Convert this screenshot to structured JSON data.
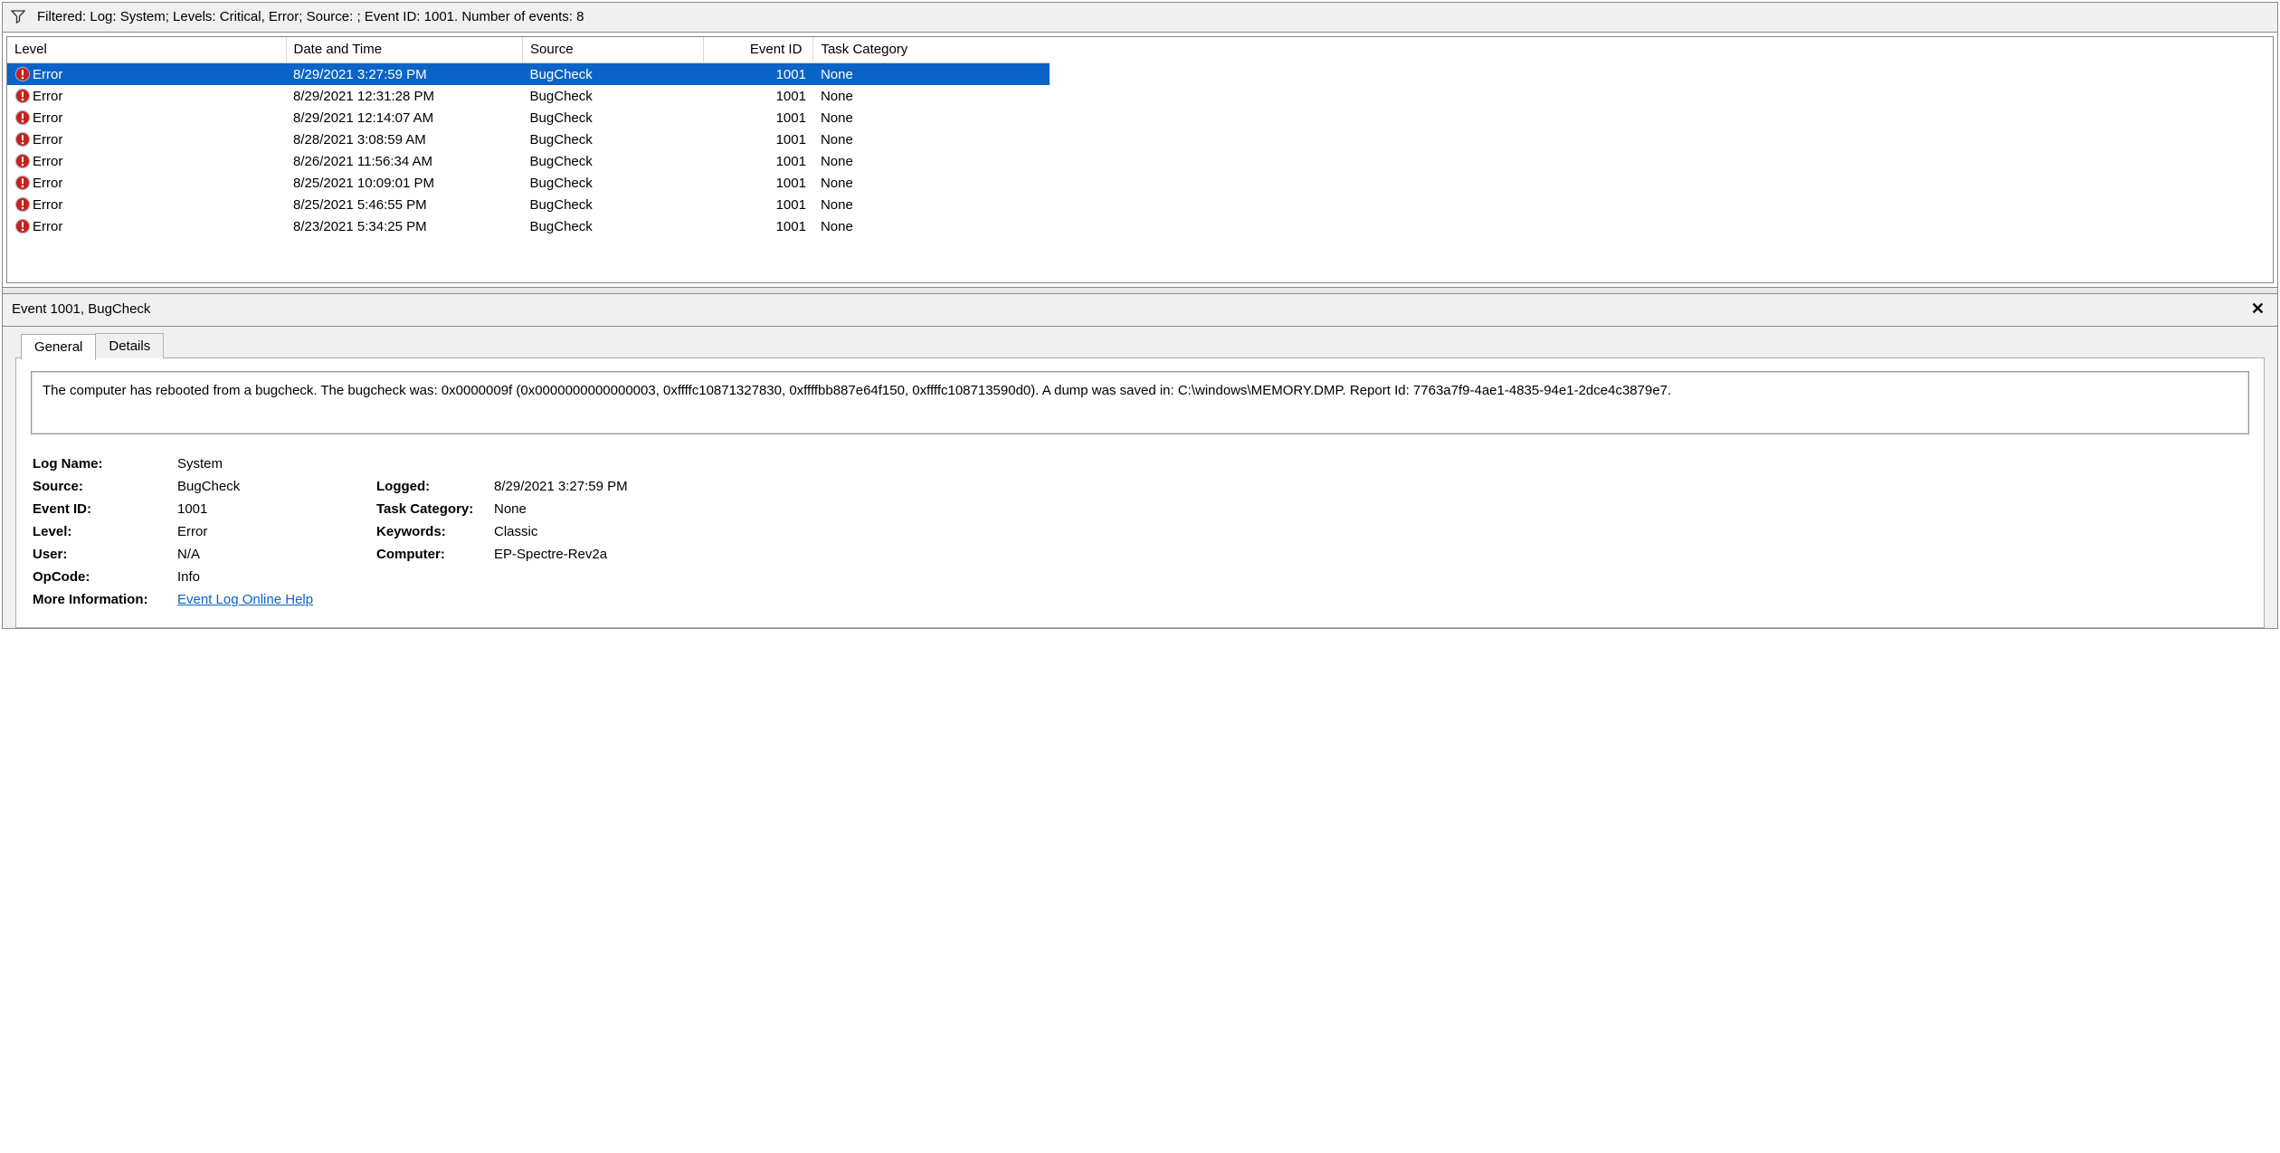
{
  "filter_text": "Filtered: Log: System; Levels: Critical, Error; Source: ; Event ID: 1001. Number of events: 8",
  "columns": {
    "level": "Level",
    "datetime": "Date and Time",
    "source": "Source",
    "eventid": "Event ID",
    "taskcat": "Task Category"
  },
  "events": [
    {
      "level": "Error",
      "datetime": "8/29/2021 3:27:59 PM",
      "source": "BugCheck",
      "eventid": "1001",
      "taskcat": "None",
      "selected": true
    },
    {
      "level": "Error",
      "datetime": "8/29/2021 12:31:28 PM",
      "source": "BugCheck",
      "eventid": "1001",
      "taskcat": "None",
      "selected": false
    },
    {
      "level": "Error",
      "datetime": "8/29/2021 12:14:07 AM",
      "source": "BugCheck",
      "eventid": "1001",
      "taskcat": "None",
      "selected": false
    },
    {
      "level": "Error",
      "datetime": "8/28/2021 3:08:59 AM",
      "source": "BugCheck",
      "eventid": "1001",
      "taskcat": "None",
      "selected": false
    },
    {
      "level": "Error",
      "datetime": "8/26/2021 11:56:34 AM",
      "source": "BugCheck",
      "eventid": "1001",
      "taskcat": "None",
      "selected": false
    },
    {
      "level": "Error",
      "datetime": "8/25/2021 10:09:01 PM",
      "source": "BugCheck",
      "eventid": "1001",
      "taskcat": "None",
      "selected": false
    },
    {
      "level": "Error",
      "datetime": "8/25/2021 5:46:55 PM",
      "source": "BugCheck",
      "eventid": "1001",
      "taskcat": "None",
      "selected": false
    },
    {
      "level": "Error",
      "datetime": "8/23/2021 5:34:25 PM",
      "source": "BugCheck",
      "eventid": "1001",
      "taskcat": "None",
      "selected": false
    }
  ],
  "detail": {
    "title": "Event 1001, BugCheck",
    "tabs": {
      "general": "General",
      "details": "Details"
    },
    "description": "The computer has rebooted from a bugcheck.  The bugcheck was: 0x0000009f (0x0000000000000003, 0xffffc10871327830, 0xffffbb887e64f150, 0xffffc108713590d0). A dump was saved in: C:\\windows\\MEMORY.DMP. Report Id: 7763a7f9-4ae1-4835-94e1-2dce4c3879e7.",
    "labels": {
      "log_name": "Log Name:",
      "source": "Source:",
      "event_id": "Event ID:",
      "level": "Level:",
      "user": "User:",
      "opcode": "OpCode:",
      "logged": "Logged:",
      "task_category": "Task Category:",
      "keywords": "Keywords:",
      "computer": "Computer:",
      "more_info": "More Information:"
    },
    "values": {
      "log_name": "System",
      "source": "BugCheck",
      "event_id": "1001",
      "level": "Error",
      "user": "N/A",
      "opcode": "Info",
      "logged": "8/29/2021 3:27:59 PM",
      "task_category": "None",
      "keywords": "Classic",
      "computer": "EP-Spectre-Rev2a",
      "more_info_link": "Event Log Online Help"
    }
  }
}
